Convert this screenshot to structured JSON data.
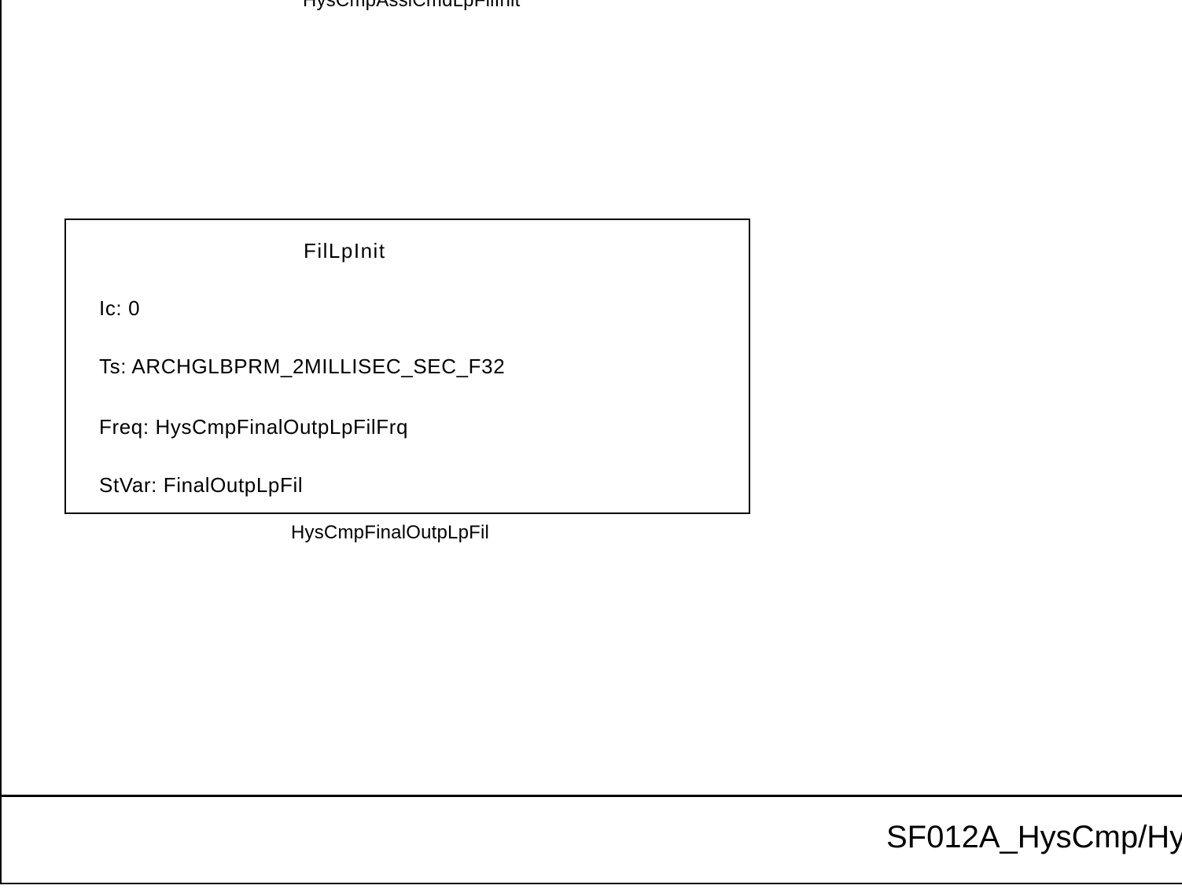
{
  "diagram": {
    "top_caption": "HysCmpAssiCmdLpFilInit",
    "block": {
      "title": "FilLpInit",
      "params": {
        "ic": "Ic: 0",
        "ts": "Ts: ARCHGLBPRM_2MILLISEC_SEC_F32",
        "freq": "Freq: HysCmpFinalOutpLpFilFrq",
        "stvar": "StVar: FinalOutpLpFil"
      },
      "caption": "HysCmpFinalOutpLpFil"
    },
    "footer_text": "SF012A_HysCmp/Hy"
  }
}
